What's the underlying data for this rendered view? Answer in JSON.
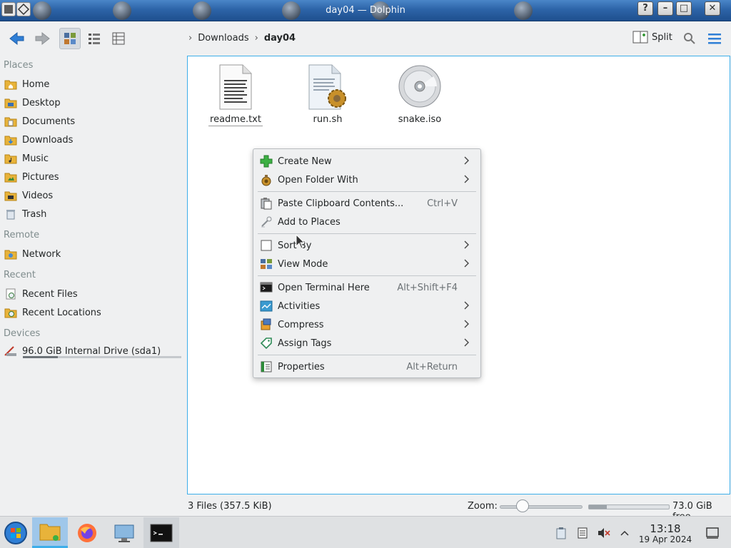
{
  "window": {
    "title": "day04 — Dolphin"
  },
  "titlebar_buttons": {
    "help": "?",
    "minimize": "–",
    "maximize": "□",
    "close": "✕"
  },
  "toolbar": {
    "split_label": "Split"
  },
  "breadcrumb": {
    "items": [
      "Downloads",
      "day04"
    ]
  },
  "sidebar": {
    "places_header": "Places",
    "places": [
      {
        "label": "Home",
        "icon": "home-folder-icon"
      },
      {
        "label": "Desktop",
        "icon": "desktop-folder-icon"
      },
      {
        "label": "Documents",
        "icon": "documents-folder-icon"
      },
      {
        "label": "Downloads",
        "icon": "downloads-folder-icon"
      },
      {
        "label": "Music",
        "icon": "music-folder-icon"
      },
      {
        "label": "Pictures",
        "icon": "pictures-folder-icon"
      },
      {
        "label": "Videos",
        "icon": "videos-folder-icon"
      },
      {
        "label": "Trash",
        "icon": "trash-icon"
      }
    ],
    "remote_header": "Remote",
    "remote": [
      {
        "label": "Network",
        "icon": "network-folder-icon"
      }
    ],
    "recent_header": "Recent",
    "recent": [
      {
        "label": "Recent Files",
        "icon": "recent-files-icon"
      },
      {
        "label": "Recent Locations",
        "icon": "recent-locations-icon"
      }
    ],
    "devices_header": "Devices",
    "devices": [
      {
        "label": "96.0 GiB Internal Drive (sda1)",
        "icon": "hard-drive-icon",
        "usage_fraction": 0.22
      }
    ]
  },
  "files": [
    {
      "name": "readme.txt",
      "icon": "text-file-icon"
    },
    {
      "name": "run.sh",
      "icon": "shell-script-icon"
    },
    {
      "name": "snake.iso",
      "icon": "disc-image-icon"
    }
  ],
  "context_menu": {
    "items": [
      {
        "label": "Create New",
        "shortcut": "",
        "submenu": true,
        "icon": "plus-icon"
      },
      {
        "label": "Open Folder With",
        "shortcut": "",
        "submenu": true,
        "icon": "open-with-icon"
      },
      {
        "label": "Paste Clipboard Contents...",
        "shortcut": "Ctrl+V",
        "submenu": false,
        "icon": "paste-icon"
      },
      {
        "label": "Add to Places",
        "shortcut": "",
        "submenu": false,
        "icon": "bookmark-icon"
      },
      {
        "label": "Sort By",
        "shortcut": "",
        "submenu": true,
        "icon": "sort-icon"
      },
      {
        "label": "View Mode",
        "shortcut": "",
        "submenu": true,
        "icon": "view-mode-icon"
      },
      {
        "label": "Open Terminal Here",
        "shortcut": "Alt+Shift+F4",
        "submenu": false,
        "icon": "terminal-icon"
      },
      {
        "label": "Activities",
        "shortcut": "",
        "submenu": true,
        "icon": "activities-icon"
      },
      {
        "label": "Compress",
        "shortcut": "",
        "submenu": true,
        "icon": "compress-icon"
      },
      {
        "label": "Assign Tags",
        "shortcut": "",
        "submenu": true,
        "icon": "tag-icon"
      },
      {
        "label": "Properties",
        "shortcut": "Alt+Return",
        "submenu": false,
        "icon": "properties-icon"
      }
    ]
  },
  "statusbar": {
    "summary": "3 Files (357.5 KiB)",
    "zoom_label": "Zoom:",
    "zoom_level_fraction": 0.28,
    "free_space": "73.0 GiB free",
    "used_fraction": 0.22
  },
  "taskbar": {
    "time": "13:18",
    "date": "19 Apr 2024"
  },
  "colors": {
    "accent": "#3daee9",
    "window_bg": "#eff0f1",
    "view_bg": "#ffffff"
  }
}
